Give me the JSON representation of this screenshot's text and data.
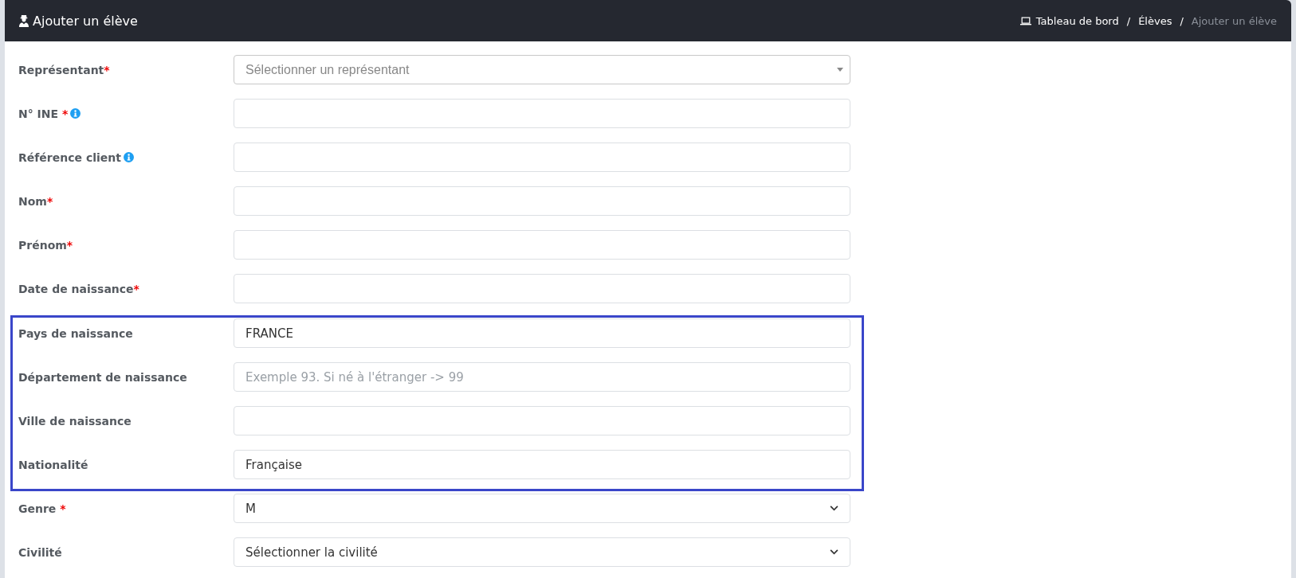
{
  "header": {
    "title": "Ajouter un élève",
    "breadcrumb": [
      {
        "label": "Tableau de bord",
        "current": false
      },
      {
        "separator": "/",
        "label": "Élèves",
        "current": false
      },
      {
        "separator": "/",
        "label": "Ajouter un élève",
        "current": true
      }
    ]
  },
  "sections": [
    {
      "highlighted": false,
      "fields": [
        {
          "label": "Représentant",
          "required_mark": "*",
          "info": false,
          "kind": "search-select",
          "placeholder": "Sélectionner un représentant"
        },
        {
          "label": "N° INE",
          "required_mark": " *",
          "info": true,
          "kind": "text"
        },
        {
          "label": "Référence client",
          "info": true,
          "kind": "text"
        },
        {
          "label": "Nom",
          "required_mark": "*",
          "info": false,
          "kind": "text"
        },
        {
          "label": "Prénom",
          "required_mark": "*",
          "info": false,
          "kind": "text"
        },
        {
          "label": "Date de naissance",
          "required_mark": "*",
          "info": false,
          "kind": "text"
        }
      ]
    },
    {
      "highlighted": true,
      "fields": [
        {
          "label": "Pays de naissance",
          "info": false,
          "kind": "text",
          "value": "FRANCE"
        },
        {
          "label": "Département de naissance",
          "info": false,
          "kind": "text",
          "placeholder": "Exemple 93. Si né à l'étranger -> 99"
        },
        {
          "label": "Ville de naissance",
          "info": false,
          "kind": "text"
        },
        {
          "label": "Nationalité",
          "info": false,
          "kind": "text",
          "value": "Française"
        }
      ]
    },
    {
      "highlighted": false,
      "fields": [
        {
          "label": "Genre",
          "required_mark": " *",
          "info": false,
          "kind": "select",
          "value": "M"
        },
        {
          "label": "Civilité",
          "info": false,
          "kind": "select",
          "value": "Sélectionner la civilité"
        }
      ]
    }
  ]
}
